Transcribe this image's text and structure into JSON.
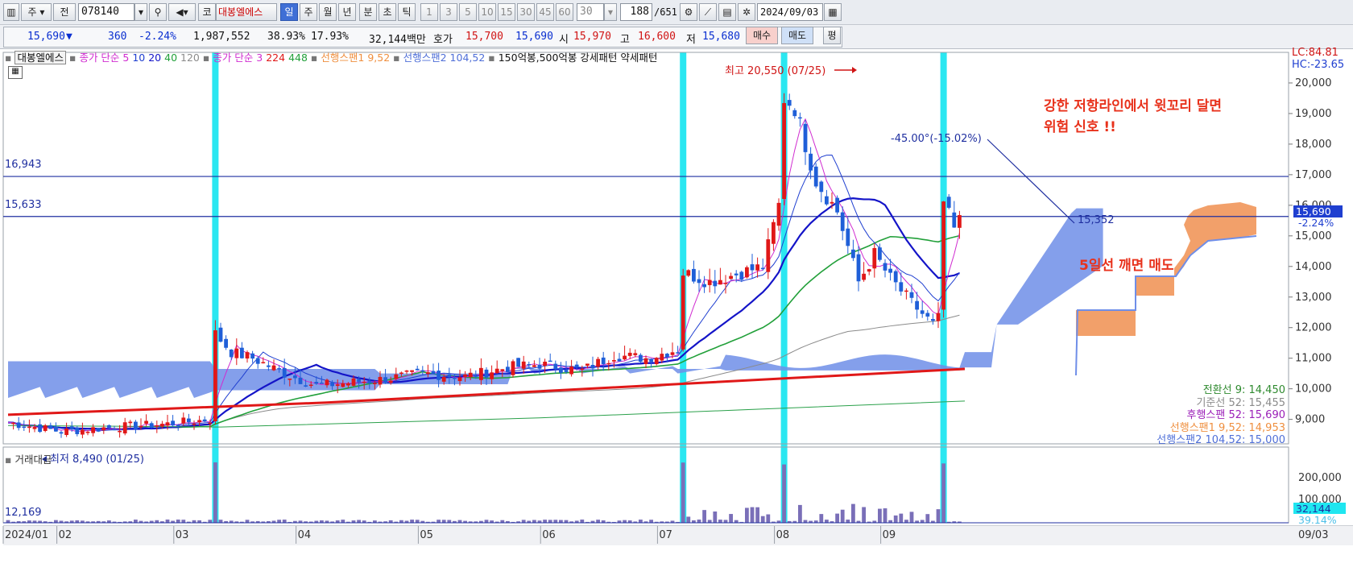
{
  "toolbar": {
    "market_label": "주",
    "prev_label": "전",
    "code": "078140",
    "exchange_label": "코",
    "stock_name": "대봉엘에스",
    "periods": [
      "일",
      "주",
      "월",
      "년",
      "분",
      "초",
      "틱"
    ],
    "active_period": "일",
    "minute_intervals": [
      "1",
      "3",
      "5",
      "10",
      "15",
      "30",
      "45",
      "60"
    ],
    "interval_input": "30",
    "count": "188",
    "total": "/651",
    "date": "2024/09/03"
  },
  "quote": {
    "price": "15,690",
    "change_arrow": "▼",
    "change": "360",
    "change_pct": "-2.24%",
    "volume": "1,987,552",
    "vol_ratio": "38.93%",
    "turnover": "17.93%",
    "amount": "32,144백만",
    "bid_label": "호가",
    "bid1": "15,700",
    "bid2": "15,690",
    "open_label": "시",
    "open": "15,970",
    "high_label": "고",
    "high": "16,600",
    "low_label": "저",
    "low": "15,680",
    "buy_label": "매수",
    "sell_label": "매도",
    "eval_label": "평"
  },
  "legend": {
    "name": "대봉엘에스",
    "ma_label": "종가 단순",
    "ma_periods": [
      "5",
      "10",
      "20",
      "40",
      "120"
    ],
    "ma2_label": "종가 단순",
    "ma2_periods": [
      "3",
      "224",
      "448"
    ],
    "span1": "선행스팬1 9,52",
    "span2": "선행스팬2 104,52",
    "pattern1": "150억봉,500억봉 강세패턴",
    "pattern2": "약세패턴"
  },
  "annotations": {
    "high": "최고 20,550 (07/25)",
    "low": "최저 8,490 (01/25)",
    "level1": "16,943",
    "level2": "15,633",
    "trend_pct": "-45.00°(-15.02%)",
    "trend_end": "15,352",
    "note1a": "강한 저항라인에서 윗꼬리 달면",
    "note1b": "위험 신호 !!",
    "note2": "5일선 깨면 매도"
  },
  "right_axis": {
    "lc": "LC:84.81",
    "hc": "HC:-23.65",
    "cur_price": "15,690",
    "cur_pct": "-2.24%",
    "legend_lines": [
      {
        "text": "전환선 9: 14,450",
        "color": "#2f8a2f"
      },
      {
        "text": "기준선 52: 15,455",
        "color": "#8a8a8a"
      },
      {
        "text": "후행스팬 52: 15,690",
        "color": "#9b1fb8"
      },
      {
        "text": "선행스팬1 9,52: 14,953",
        "color": "#ef8f3f"
      },
      {
        "text": "선행스팬2 104,52: 15,000",
        "color": "#4f6fd8"
      }
    ]
  },
  "volume_panel": {
    "title": "거래대금",
    "left_value": "12,169",
    "ticks": [
      "200,000",
      "100,000"
    ],
    "cur_value": "32,144",
    "cur_pct": "39.14%"
  },
  "chart_data": {
    "type": "candlestick",
    "price_ticks": [
      20000,
      19000,
      18000,
      17000,
      16000,
      15000,
      14000,
      13000,
      12000,
      11000,
      10000,
      9000
    ],
    "ylim": [
      8200,
      21000
    ],
    "x_labels": [
      "2024/01",
      "02",
      "03",
      "04",
      "05",
      "06",
      "07",
      "08",
      "09"
    ],
    "right_date": "09/03",
    "horizontal_levels": [
      16943,
      15633
    ],
    "series_colors": {
      "ma5": "#d02bd0",
      "ma10": "#1f3fd0",
      "ma20": "#1414c8",
      "ma40": "#22a03a",
      "ma120": "#8b8b8b",
      "ma224": "#e01818",
      "ma448": "#2aa04a",
      "span1": "#f2a06a",
      "span2": "#6f8ee8"
    },
    "highlight_color": "#1fe6f0",
    "up_color": "#e01818",
    "down_color": "#1f5fd8"
  }
}
